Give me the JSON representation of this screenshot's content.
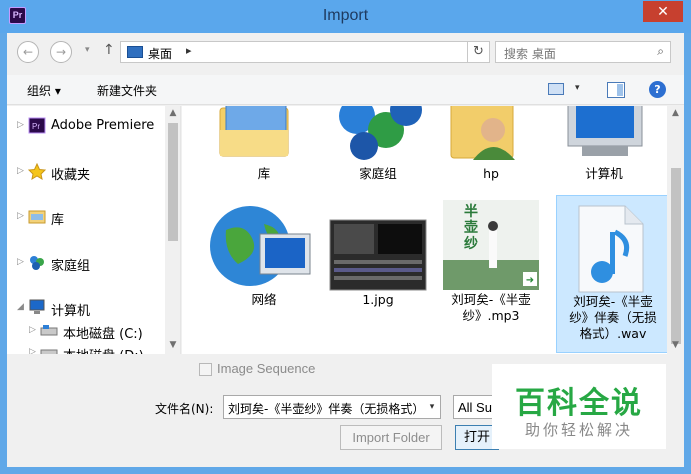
{
  "window": {
    "title": "Import",
    "app_icon_text": "Pr",
    "close_glyph": "✕"
  },
  "address": {
    "back_glyph": "←",
    "forward_glyph": "→",
    "recent_glyph": "▾",
    "up_glyph": "↑",
    "path": "桌面",
    "path_chevron": "▸",
    "refresh_glyph": "↻",
    "search_placeholder": "搜索 桌面",
    "search_glyph": "⌕"
  },
  "toolbar": {
    "organize_label": "组织 ▾",
    "new_folder_label": "新建文件夹",
    "view_arrow": "▾",
    "help_glyph": "?"
  },
  "sidebar": {
    "items": [
      {
        "label": "Adobe Premiere",
        "icon": "premiere-icon"
      },
      {
        "label": "收藏夹",
        "icon": "favorites-star-icon"
      },
      {
        "label": "库",
        "icon": "library-icon"
      },
      {
        "label": "家庭组",
        "icon": "homegroup-icon"
      },
      {
        "label": "计算机",
        "icon": "computer-icon"
      },
      {
        "label": "本地磁盘 (C:)",
        "icon": "drive-icon"
      },
      {
        "label": "本地磁盘 (D:)",
        "icon": "drive-icon"
      }
    ],
    "collapsed_glyph": "▷",
    "expanded_glyph": "◢"
  },
  "files": [
    {
      "label": "库",
      "icon": "library-folder-icon"
    },
    {
      "label": "家庭组",
      "icon": "homegroup-icon"
    },
    {
      "label": "hp",
      "icon": "user-folder-icon"
    },
    {
      "label": "计算机",
      "icon": "computer-icon"
    },
    {
      "label": "网络",
      "icon": "network-globe-icon"
    },
    {
      "label": "1.jpg",
      "icon": "image-thumbnail"
    },
    {
      "label_lines": [
        "刘珂矣-《半壶",
        "纱》.mp3"
      ],
      "icon": "album-art-thumbnail",
      "album_text": "半壶纱"
    },
    {
      "label_lines": [
        "刘珂矣-《半壶",
        "纱》伴奏（无损",
        "格式）.wav"
      ],
      "icon": "music-note-file-icon",
      "selected": true
    }
  ],
  "bottom": {
    "image_sequence_label": "Image Sequence",
    "filename_label": "文件名(N):",
    "filename_value": "刘珂矣-《半壶纱》伴奏（无损格式）.wav",
    "filename_arrow": "▾",
    "filter_value": "All Supported Media",
    "import_folder_label": "Import Folder",
    "open_label": "打开(O)"
  },
  "watermark": {
    "title": "百科全说",
    "subtitle": "助你轻松解决"
  },
  "colors": {
    "titlebar": "#5aa7ec",
    "close": "#c7402f",
    "selection": "#cce8ff",
    "watermark_green": "#27a844"
  }
}
